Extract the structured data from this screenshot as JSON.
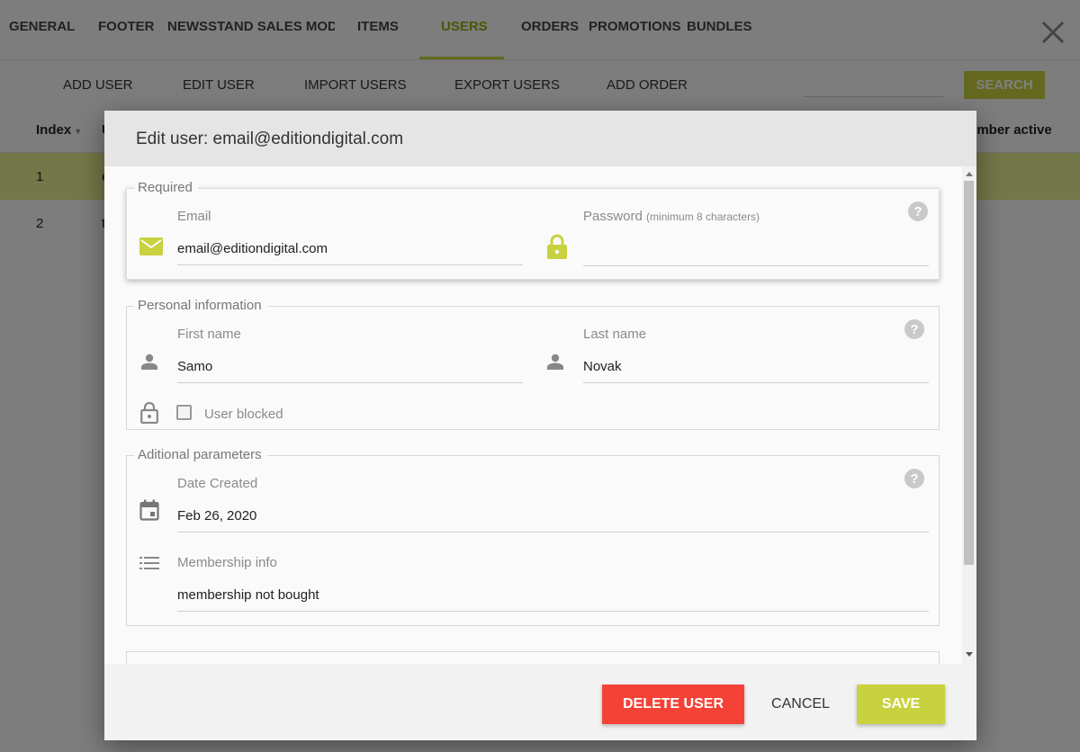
{
  "nav": {
    "tabs": [
      {
        "label": "GENERAL"
      },
      {
        "label": "FOOTER"
      },
      {
        "label": "NEWSSTAND SALES MODEL"
      },
      {
        "label": "ITEMS"
      },
      {
        "label": "USERS"
      },
      {
        "label": "ORDERS"
      },
      {
        "label": "PROMOTIONS"
      },
      {
        "label": "BUNDLES"
      }
    ],
    "active_tab": "USERS",
    "close_icon": "close-icon"
  },
  "actions": {
    "items": [
      {
        "label": "ADD USER"
      },
      {
        "label": "EDIT USER"
      },
      {
        "label": "IMPORT USERS"
      },
      {
        "label": "EXPORT USERS"
      },
      {
        "label": "ADD ORDER"
      }
    ],
    "search_label": "SEARCH"
  },
  "table": {
    "headers": [
      "Index",
      "U",
      "ember active"
    ],
    "rows": [
      {
        "index": "1",
        "user": "e"
      },
      {
        "index": "2",
        "user": "t"
      }
    ]
  },
  "dialog": {
    "title": "Edit user: email@editiondigital.com",
    "required": {
      "legend": "Required",
      "email_label": "Email",
      "email_value": "email@editiondigital.com",
      "password_label": "Password",
      "password_hint": "(minimum 8 characters)",
      "password_value": ""
    },
    "personal": {
      "legend": "Personal information",
      "first_name_label": "First name",
      "first_name_value": "Samo",
      "last_name_label": "Last name",
      "last_name_value": "Novak",
      "blocked_label": "User blocked",
      "blocked": false
    },
    "additional": {
      "legend": "Aditional parameters",
      "date_label": "Date Created",
      "date_value": "Feb 26, 2020",
      "membership_label": "Membership info",
      "membership_value": "membership not bought"
    },
    "help_glyph": "?",
    "buttons": {
      "delete": "DELETE USER",
      "cancel": "CANCEL",
      "save": "SAVE"
    }
  },
  "colors": {
    "accent": "#c8d23f",
    "danger": "#f44336",
    "active_tab": "#9aab10",
    "selected_row": "#e8ef8f"
  }
}
